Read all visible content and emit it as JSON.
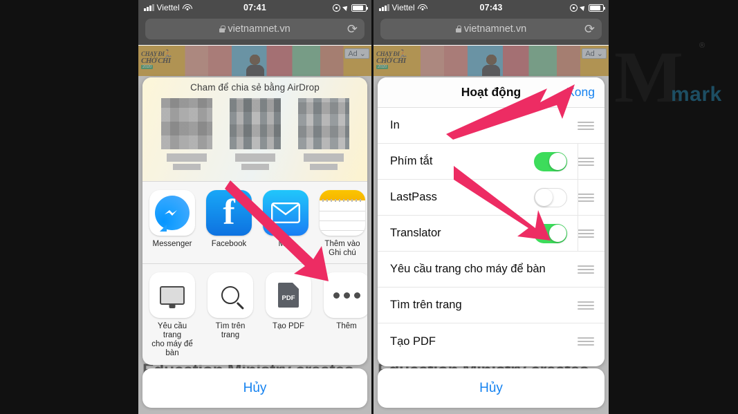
{
  "left_phone": {
    "status_bar": {
      "carrier": "Viettel",
      "time": "07:41",
      "icons": [
        "signal-bars",
        "wifi",
        "rotation-lock",
        "location-arrow",
        "battery"
      ]
    },
    "url_bar": {
      "url": "vietnamnet.vn",
      "lock_icon": "lock-icon",
      "reload_icon": "reload-icon"
    },
    "ad_banner": {
      "logo_line1": "CHẠY ĐI",
      "logo_line2": "CHỜ CHI",
      "logo_tag": "2020",
      "badge": "Ad",
      "badge_caret": "⌄"
    },
    "article_headline": "Education Ministry creates",
    "share_sheet": {
      "airdrop_title": "Cham để chia sẻ bằng AirDrop",
      "apps": [
        {
          "name": "Messenger",
          "icon": "messenger-icon"
        },
        {
          "name": "Facebook",
          "icon": "facebook-icon"
        },
        {
          "name": "Mail",
          "icon": "mail-icon"
        },
        {
          "name": "Thêm vào\nGhi chú",
          "icon": "notes-icon"
        }
      ],
      "actions": [
        {
          "name": "Yêu cầu trang\ncho máy để bàn",
          "icon": "desktop-monitor-icon"
        },
        {
          "name": "Tìm trên\ntrang",
          "icon": "magnifier-icon"
        },
        {
          "name": "Tạo PDF",
          "icon": "pdf-file-icon"
        },
        {
          "name": "Thêm",
          "icon": "more-dots-icon"
        }
      ]
    },
    "cancel_label": "Hủy"
  },
  "right_phone": {
    "status_bar": {
      "carrier": "Viettel",
      "time": "07:43",
      "icons": [
        "signal-bars",
        "wifi",
        "rotation-lock",
        "location-arrow",
        "battery"
      ]
    },
    "url_bar": {
      "url": "vietnamnet.vn",
      "lock_icon": "lock-icon",
      "reload_icon": "reload-icon"
    },
    "ad_banner": {
      "badge": "Ad",
      "badge_caret": "⌄"
    },
    "article_headline": "Education Ministry creates",
    "activity_sheet": {
      "title": "Hoạt động",
      "done_label": "Xong",
      "rows": [
        {
          "label": "In",
          "toggle": null
        },
        {
          "label": "Phím tắt",
          "toggle": "on"
        },
        {
          "label": "LastPass",
          "toggle": "off"
        },
        {
          "label": "Translator",
          "toggle": "on"
        },
        {
          "label": "Yêu cầu trang cho máy để bàn",
          "toggle": null
        },
        {
          "label": "Tìm trên trang",
          "toggle": null
        },
        {
          "label": "Tạo PDF",
          "toggle": null
        }
      ]
    },
    "cancel_label": "Hủy"
  },
  "watermark": {
    "letter": "M",
    "word": "mark",
    "registered": "®"
  },
  "annotations": {
    "arrow_color": "#ED2C63",
    "arrows": [
      {
        "name": "arrow-to-more-button",
        "target": "Thêm"
      },
      {
        "name": "arrow-to-xong-button",
        "target": "Xong"
      },
      {
        "name": "arrow-to-translator-toggle",
        "target": "Translator"
      }
    ]
  },
  "colors": {
    "toggle_on": "#3DDC5B",
    "link_blue": "#1482F0",
    "status_bg": "#4B4B4B",
    "sheet_bg": "#FFFFFF"
  }
}
